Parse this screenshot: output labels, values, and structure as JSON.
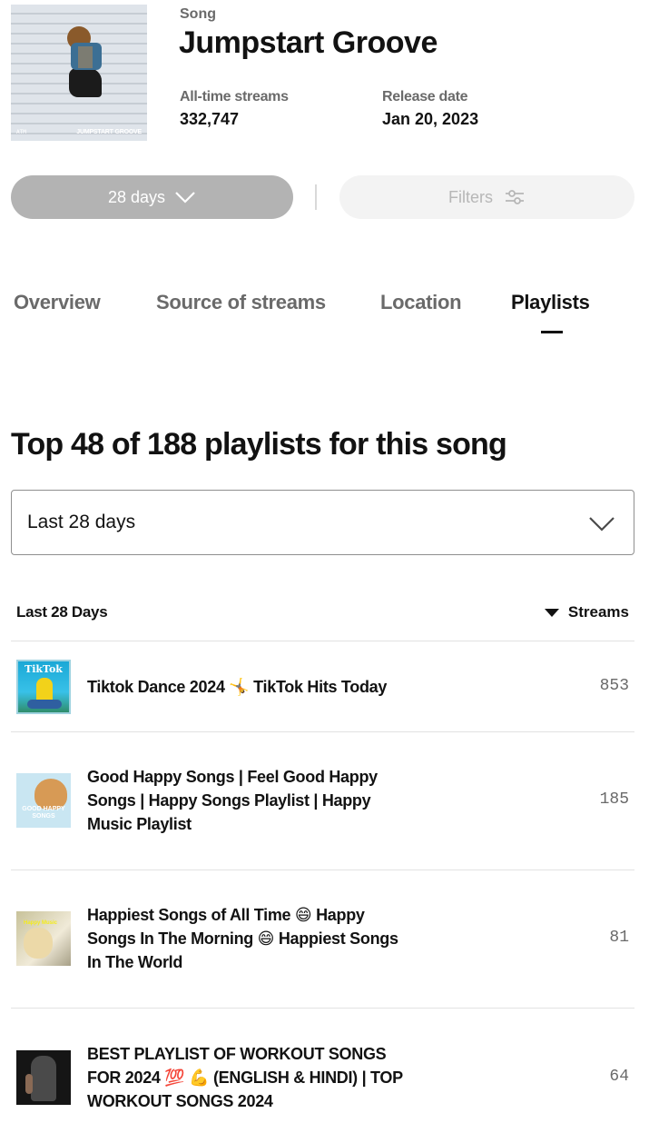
{
  "song": {
    "kind_label": "Song",
    "title": "Jumpstart Groove",
    "cover": {
      "logo_text": "ATM",
      "title_text": "JUMPSTART GROOVE"
    },
    "all_time_streams_label": "All-time streams",
    "all_time_streams_value": "332,747",
    "release_date_label": "Release date",
    "release_date_value": "Jan 20, 2023"
  },
  "controls": {
    "period_label": "28 days",
    "filters_label": "Filters"
  },
  "tabs": [
    {
      "label": "Overview",
      "active": false
    },
    {
      "label": "Source of streams",
      "active": false
    },
    {
      "label": "Location",
      "active": false
    },
    {
      "label": "Playlists",
      "active": true
    }
  ],
  "playlists_section": {
    "title": "Top 48 of 188 playlists for this song",
    "range_select_value": "Last 28 days",
    "table_header_left": "Last 28 Days",
    "table_header_right": "Streams",
    "rows": [
      {
        "name": "Tiktok Dance 2024 🤸 TikTok Hits Today",
        "streams": "853",
        "thumb_label": "TikTok"
      },
      {
        "name": "Good Happy Songs | Feel Good Happy Songs | Happy Songs Playlist | Happy Music Playlist",
        "streams": "185",
        "thumb_label": "GOOD HAPPY SONGS"
      },
      {
        "name": "Happiest Songs of All Time 😄 Happy Songs In The Morning 😄 Happiest Songs In The World",
        "streams": "81",
        "thumb_label": "Happy Music"
      },
      {
        "name": "BEST PLAYLIST OF WORKOUT SONGS FOR 2024 💯 💪 (ENGLISH & HINDI) | TOP WORKOUT SONGS 2024",
        "streams": "64",
        "thumb_label": ""
      }
    ]
  },
  "colors": {
    "text_primary": "#121212",
    "text_secondary": "#6a6a6a",
    "pill_active_bg": "#b3b3b3",
    "pill_disabled_bg": "#f3f3f3",
    "divider": "#e2e2e2"
  }
}
